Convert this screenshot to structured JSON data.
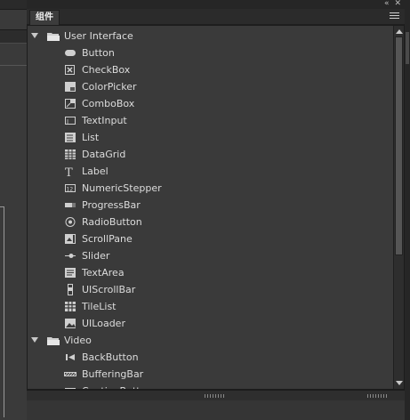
{
  "panel": {
    "tab_label": "组件",
    "top_icons": {
      "collapse": "«",
      "close": "✕"
    },
    "menu_icon": "panel-menu-icon"
  },
  "tree": {
    "categories": [
      {
        "label": "User Interface",
        "expanded": true,
        "items": [
          {
            "label": "Button",
            "icon": "button-icon"
          },
          {
            "label": "CheckBox",
            "icon": "checkbox-icon"
          },
          {
            "label": "ColorPicker",
            "icon": "colorpicker-icon"
          },
          {
            "label": "ComboBox",
            "icon": "combobox-icon"
          },
          {
            "label": "TextInput",
            "icon": "textinput-icon"
          },
          {
            "label": "List",
            "icon": "list-icon"
          },
          {
            "label": "DataGrid",
            "icon": "datagrid-icon"
          },
          {
            "label": "Label",
            "icon": "label-icon"
          },
          {
            "label": "NumericStepper",
            "icon": "numericstepper-icon"
          },
          {
            "label": "ProgressBar",
            "icon": "progressbar-icon"
          },
          {
            "label": "RadioButton",
            "icon": "radiobutton-icon"
          },
          {
            "label": "ScrollPane",
            "icon": "scrollpane-icon"
          },
          {
            "label": "Slider",
            "icon": "slider-icon"
          },
          {
            "label": "TextArea",
            "icon": "textarea-icon"
          },
          {
            "label": "UIScrollBar",
            "icon": "uiscrollbar-icon"
          },
          {
            "label": "TileList",
            "icon": "tilelist-icon"
          },
          {
            "label": "UILoader",
            "icon": "uiloader-icon"
          }
        ]
      },
      {
        "label": "Video",
        "expanded": true,
        "items": [
          {
            "label": "BackButton",
            "icon": "backbutton-icon"
          },
          {
            "label": "BufferingBar",
            "icon": "bufferingbar-icon"
          },
          {
            "label": "CaptionButton",
            "icon": "captionbutton-icon"
          }
        ]
      }
    ]
  },
  "colors": {
    "panel_bg": "#323232",
    "tree_bg": "#3a3a3a",
    "text": "#dcdcdc",
    "icon": "#cfcfcf"
  }
}
